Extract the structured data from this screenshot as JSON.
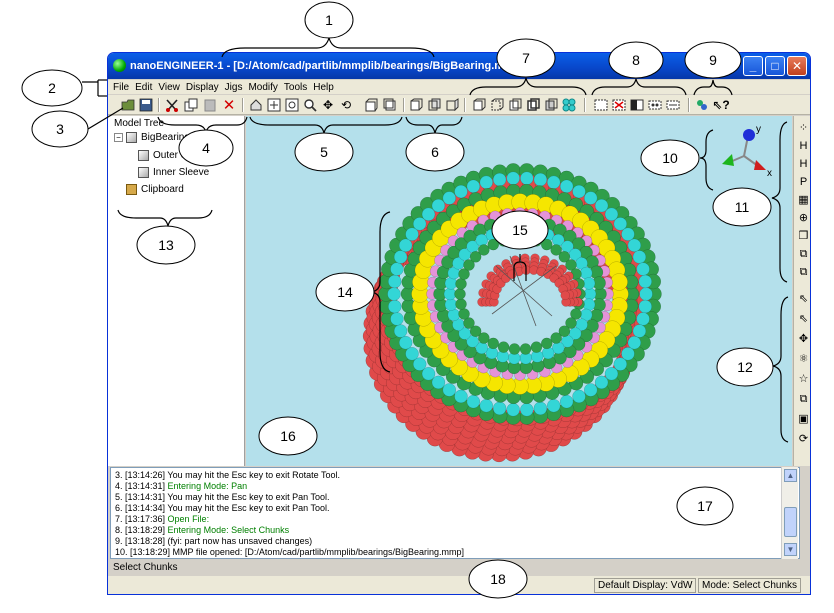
{
  "window": {
    "title": "nanoENGINEER-1 - [D:/Atom/cad/partlib/mmplib/bearings/BigBearing.mmp]",
    "min_glyph": "_",
    "max_glyph": "□",
    "close_glyph": "✕"
  },
  "menu": [
    "File",
    "Edit",
    "View",
    "Display",
    "Jigs",
    "Modify",
    "Tools",
    "Help"
  ],
  "toolbar": {
    "icons": [
      "open-file-icon",
      "save-file-icon",
      "cut-icon",
      "copy-icon",
      "paste-icon",
      "delete-icon",
      "home-view-icon",
      "fit-view-icon",
      "zoom-window-icon",
      "zoom-icon",
      "pan-icon",
      "rotate-icon",
      "ortho-icon",
      "perspective-icon",
      "front-view-icon",
      "back-view-icon",
      "right-view-icon",
      "display-default-icon",
      "display-invisible-icon",
      "display-lines-icon",
      "display-tubes-icon",
      "display-cpk-icon",
      "display-vdw-icon",
      "select-all-icon",
      "select-none-icon",
      "invert-selection-icon",
      "select-connected-icon",
      "select-doubly-icon",
      "color-icon",
      "whats-this-icon"
    ]
  },
  "model_tree": {
    "label": "Model Tree",
    "root": "BigBearing",
    "expander": "−",
    "children": [
      "Outer Sleeve",
      "Inner Sleeve"
    ],
    "clipboard": "Clipboard"
  },
  "viewport": {
    "axes": {
      "x": "x",
      "y": "y"
    }
  },
  "right_toolbar": {
    "icons": [
      "add-atom-icon",
      "add-hydrogen-icon",
      "remove-hydrogen-icon",
      "passivate-icon",
      "build-crystal-icon",
      "cookie-cutter-icon",
      "extrude-icon",
      "fuse-chunks-icon",
      "move-chunks-icon",
      "select-atoms-icon",
      "select-chunks-icon",
      "move-icon",
      "atom-icon",
      "star-icon",
      "copy-chunk-icon",
      "display-icon",
      "rotate-chunks-icon"
    ]
  },
  "history": [
    {
      "prefix": "3. [13:14:26] ",
      "text": "You may hit the Esc key to exit Rotate Tool.",
      "green": false
    },
    {
      "prefix": "4. [13:14:31] ",
      "text": "Entering Mode: Pan",
      "green": true
    },
    {
      "prefix": "5. [13:14:31] ",
      "text": "You may hit the Esc key to exit Pan Tool.",
      "green": false
    },
    {
      "prefix": "6. [13:14:34] ",
      "text": "You may hit the Esc key to exit Pan Tool.",
      "green": false
    },
    {
      "prefix": "7. [13:17:36] ",
      "text": "Open File:",
      "green": true
    },
    {
      "prefix": "8. [13:18:29] ",
      "text": "Entering Mode: Select Chunks",
      "green": true
    },
    {
      "prefix": "9. [13:18:28] ",
      "text": "(fyi: part now has unsaved changes)",
      "green": false
    },
    {
      "prefix": "10. [13:18:29] ",
      "text": "MMP file opened: [D:/Atom/cad/partlib/mmplib/bearings/BigBearing.mmp]",
      "green": false
    }
  ],
  "command_line": "Select Chunks",
  "status": {
    "display": "Default Display: VdW",
    "mode": "Mode: Select Chunks"
  },
  "callouts": [
    "1",
    "2",
    "3",
    "4",
    "5",
    "6",
    "7",
    "8",
    "9",
    "10",
    "11",
    "12",
    "13",
    "14",
    "15",
    "16",
    "17",
    "18"
  ],
  "colors": {
    "title_blue": "#0846c9",
    "viewport_bg": "#b4e0eb",
    "history_green": "#008000",
    "ring_red": "#e04a4a",
    "ring_green": "#2f9e4a",
    "ring_cyan": "#33d6d6",
    "ring_yellow": "#f5e600",
    "ring_pink": "#e493d8"
  }
}
